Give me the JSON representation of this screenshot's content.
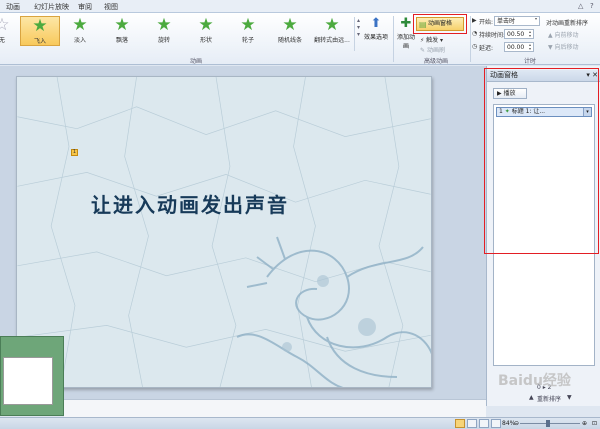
{
  "tabs": [
    "动画",
    "幻灯片放映",
    "审阅",
    "视图"
  ],
  "window_controls": [
    "△",
    "?"
  ],
  "effects": [
    {
      "label": "无",
      "selected": false
    },
    {
      "label": "飞入",
      "selected": true
    },
    {
      "label": "淡入",
      "selected": false
    },
    {
      "label": "飘落",
      "selected": false
    },
    {
      "label": "旋转",
      "selected": false
    },
    {
      "label": "形状",
      "selected": false
    },
    {
      "label": "轮子",
      "selected": false
    },
    {
      "label": "随机线条",
      "selected": false
    },
    {
      "label": "翻转式由远...",
      "selected": false
    }
  ],
  "effect_options_label": "效果选项",
  "group_animation": "动画",
  "add_animation_label": "添加动画",
  "animation_pane_label": "动画窗格",
  "trigger_label": "触发",
  "animation_painter_label": "动画刷",
  "group_advanced": "高级动画",
  "timing": {
    "start_label": "开始:",
    "start_value": "单击时",
    "duration_label": "持续时间:",
    "duration_value": "00.50",
    "delay_label": "延迟:",
    "delay_value": "00.00",
    "reorder_label": "对动画重新排序",
    "move_earlier": "▲ 向前移动",
    "move_later": "▼ 向后移动",
    "group_label": "计时"
  },
  "slide": {
    "title": "让进入动画发出声音",
    "anim_tag": "1"
  },
  "pane": {
    "title": "动画窗格",
    "play_label": "播放",
    "items": [
      {
        "index": "1",
        "text": "标题 1: 让..."
      }
    ],
    "footer_nav": "0 ▸ 2",
    "rearrange_label": "重新排序"
  },
  "status": {
    "zoom": "84%"
  },
  "watermark": "Baidu经验"
}
